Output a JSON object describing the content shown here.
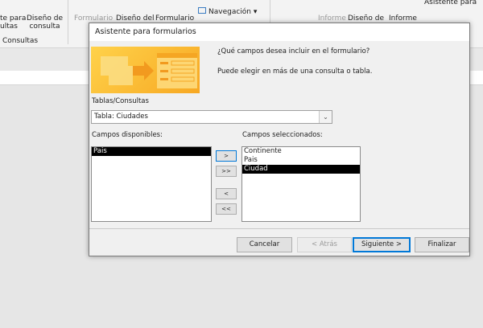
{
  "ribbon": {
    "consultas_wizard_label": [
      "te para",
      "ultas"
    ],
    "consultas_design_label": [
      "Diseño de",
      "consulta"
    ],
    "consultas_group": "Consultas",
    "form_label": "Formulario",
    "form_design_label": "Diseño del",
    "blank_form_label": "Formulario",
    "navigation_label": "Navegación ▾",
    "report_label": "Informe",
    "report_design_label": "Diseño de",
    "blank_report_label": "Informe",
    "report_wizard_label": "Asistente para"
  },
  "dialog": {
    "title": "Asistente para formularios",
    "question": "¿Qué campos desea incluir en el formulario?",
    "hint": "Puede elegir en más de una consulta o tabla.",
    "tables_label": "Tablas/Consultas",
    "table_value": "Tabla: Ciudades",
    "available_label": "Campos disponibles:",
    "selected_label": "Campos seleccionados:",
    "available_fields": [
      "Pais"
    ],
    "selected_fields": [
      "Continente",
      "Pais",
      "Ciudad"
    ],
    "move_one": ">",
    "move_all": ">>",
    "remove_one": "<",
    "remove_all": "<<",
    "cancel": "Cancelar",
    "back": "< Atrás",
    "next": "Siguiente >",
    "finish": "Finalizar"
  }
}
